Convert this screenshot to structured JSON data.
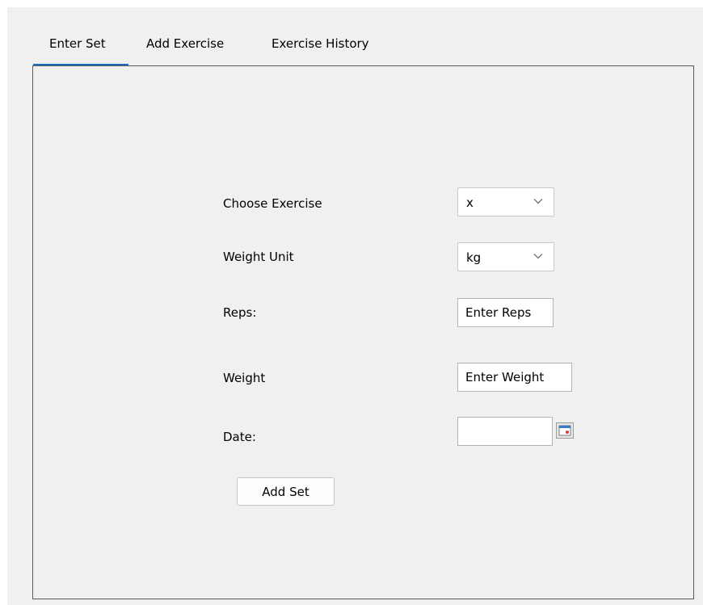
{
  "tabs": [
    {
      "label": "Enter Set",
      "selected": true
    },
    {
      "label": "Add Exercise",
      "selected": false
    },
    {
      "label": "Exercise History",
      "selected": false
    }
  ],
  "form": {
    "exercise_label": "Choose Exercise",
    "exercise_value": "x",
    "weight_unit_label": "Weight Unit",
    "weight_unit_value": "kg",
    "reps_label": "Reps:",
    "reps_value": "Enter Reps",
    "weight_label": "Weight",
    "weight_value": "Enter Weight",
    "date_label": "Date:",
    "date_value": "",
    "add_set_button": "Add Set"
  },
  "colors": {
    "tab_underline": "#1a6ec0",
    "window_background": "#f0f0f0",
    "panel_border": "#5a5a5a"
  },
  "icons": {
    "dropdown": "chevron-down-icon",
    "date_picker": "calendar-icon"
  }
}
